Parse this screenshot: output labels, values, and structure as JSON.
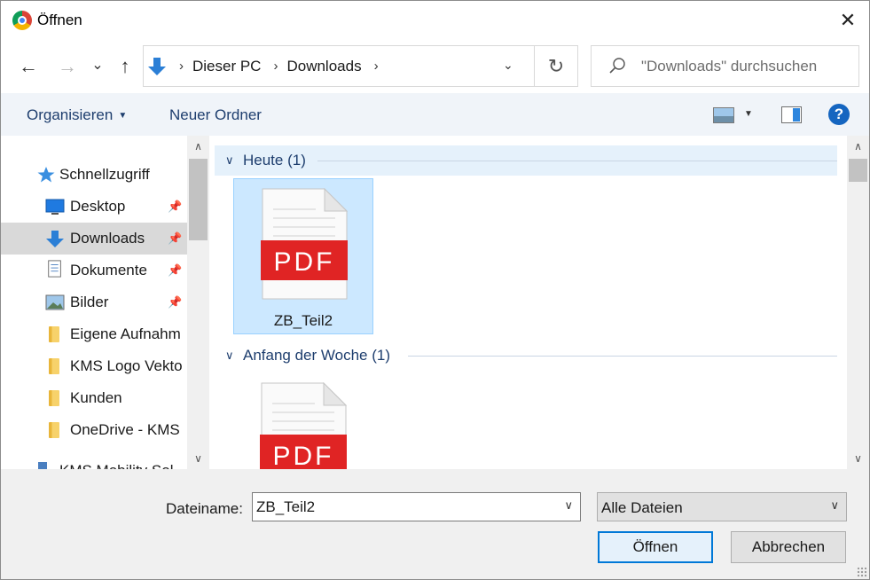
{
  "window": {
    "title": "Öffnen",
    "close_glyph": "✕"
  },
  "nav": {
    "back_glyph": "←",
    "forward_glyph": "→",
    "recent_glyph": "⌄",
    "up_glyph": "↑",
    "address": {
      "crumbs": [
        "Dieser PC",
        "Downloads"
      ],
      "sep": "›",
      "dropdown_glyph": "⌄",
      "refresh_glyph": "↻"
    },
    "search": {
      "placeholder": "\"Downloads\" durchsuchen"
    }
  },
  "toolbar": {
    "organize_label": "Organisieren",
    "new_folder_label": "Neuer Ordner",
    "help_glyph": "?"
  },
  "sidebar": {
    "quick_access_label": "Schnellzugriff",
    "items": [
      {
        "label": "Desktop",
        "icon": "desktop-icon",
        "pinned": true
      },
      {
        "label": "Downloads",
        "icon": "downloads-icon",
        "pinned": true,
        "selected": true
      },
      {
        "label": "Dokumente",
        "icon": "documents-icon",
        "pinned": true
      },
      {
        "label": "Bilder",
        "icon": "pictures-icon",
        "pinned": true
      },
      {
        "label": "Eigene Aufnahm",
        "icon": "folder-icon",
        "pinned": false
      },
      {
        "label": "KMS Logo Vekto",
        "icon": "folder-icon",
        "pinned": false
      },
      {
        "label": "Kunden",
        "icon": "folder-icon",
        "pinned": false
      },
      {
        "label": "OneDrive - KMS",
        "icon": "folder-icon",
        "pinned": false
      }
    ],
    "partial_item_label": "KMS Mobility Sol"
  },
  "main": {
    "groups": [
      {
        "label": "Heute (1)",
        "files": [
          {
            "name": "ZB_Teil2",
            "type_badge": "PDF"
          }
        ]
      },
      {
        "label": "Anfang der Woche (1)",
        "files": [
          {
            "name": "",
            "type_badge": "PDF"
          }
        ]
      }
    ]
  },
  "footer": {
    "filename_label": "Dateiname:",
    "filename_value": "ZB_Teil2",
    "filetype_value": "Alle Dateien",
    "open_label": "Öffnen",
    "cancel_label": "Abbrechen"
  },
  "colors": {
    "accent": "#0078d7",
    "pdf_red": "#e02424",
    "selection_bg": "#cce8ff",
    "group_text": "#1e3e6e"
  }
}
